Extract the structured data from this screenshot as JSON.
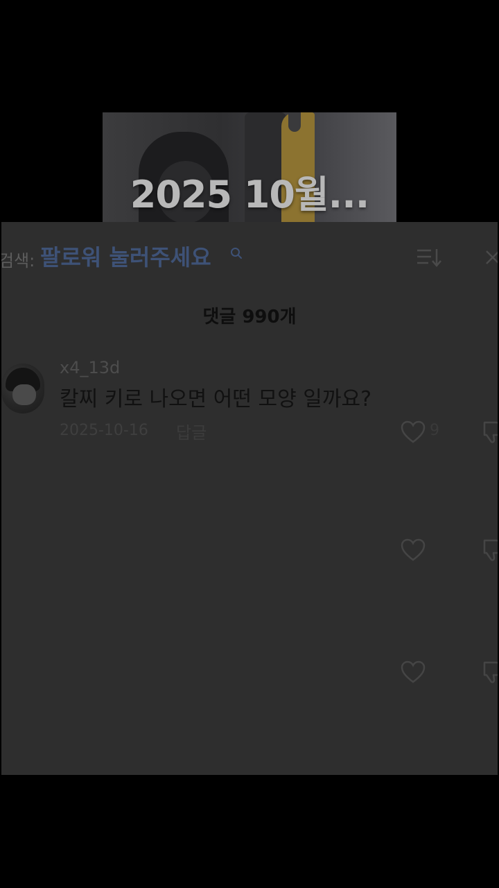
{
  "video": {
    "title": "2025 10월..."
  },
  "search": {
    "prefix": "검색:",
    "keyword": "팔로워 눌러주세요"
  },
  "comments_header": {
    "count_label": "댓글 990개"
  },
  "comments": [
    {
      "username": "x4_13d",
      "text": "칼찌 키로 나오면 어떤 모양 일까요?",
      "date": "2025-10-16",
      "reply_label": "답글",
      "like_count": "9"
    }
  ],
  "icons": {
    "search": "search-icon",
    "sort": "sort-icon",
    "close": "close-icon",
    "like": "heart-icon",
    "dislike": "thumbs-down-icon"
  },
  "colors": {
    "background": "#000000",
    "panel": "#2e2e2e",
    "search_keyword": "#3e5277"
  }
}
